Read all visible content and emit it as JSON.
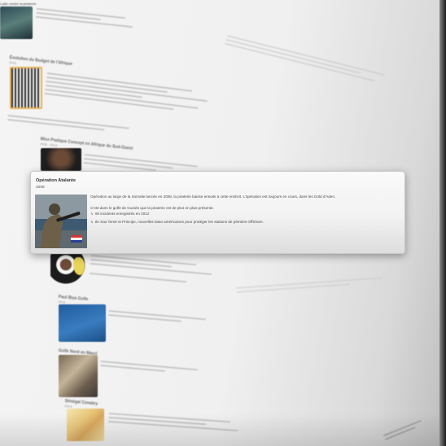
{
  "focused_entry": {
    "title": "Opération Atalante",
    "year": "2008",
    "paragraph": "Opération au large de la Somalie lancée en 2008, la piraterie baisse ensuite à cette endroit. L'opération est toujours en cours, dans les Gold d'Aden.",
    "subtitle": "C'est dans le golfe de Guinée que la piraterie est de plus en plus présente.",
    "bullets": [
      "60 incidents enregistrés en 2012",
      "Ile Sao Tomé et Principe, nouvelles base américaines pour protéger les stations de pétroles OffShore."
    ]
  },
  "background_entries": [
    {
      "title": "Lutte contre la piraterie",
      "year": ""
    },
    {
      "title": "Évolution du Budget de l'Afrique",
      "year": "2013"
    },
    {
      "title": "Mise Pratique Concept en Afrique du Sud-Ouest",
      "year": "2008 - 2013"
    },
    {
      "title": "Paul Biya Golfe",
      "year": "2013"
    },
    {
      "title": "Golfe Nord en Mauri",
      "year": ""
    },
    {
      "title": "Sénégal Conakry",
      "year": "2013"
    }
  ],
  "colors": {
    "card_bg": "#f4f4f4",
    "card_border": "#c8c8c8",
    "page_bg": "#efefef",
    "text": "#4a4a4a"
  }
}
